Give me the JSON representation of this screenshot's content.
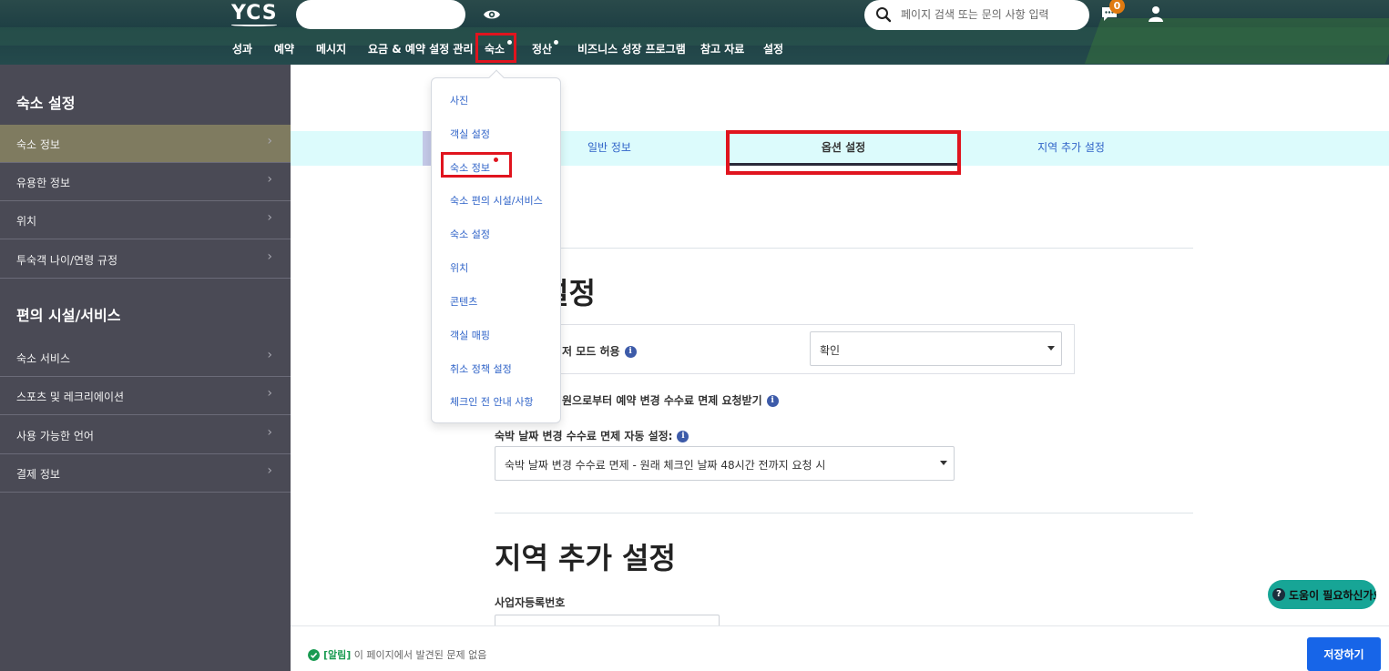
{
  "header": {
    "logo": "YCS",
    "top_input_value": "",
    "search_placeholder": "페이지 검색 또는 문의 사항 입력",
    "notification_count": "0"
  },
  "nav": {
    "items": [
      {
        "label": "성과"
      },
      {
        "label": "예약"
      },
      {
        "label": "메시지"
      },
      {
        "label": "요금 & 예약 설정 관리"
      },
      {
        "label": "숙소",
        "active": true,
        "dot": true
      },
      {
        "label": "정산",
        "dot": true
      },
      {
        "label": "비즈니스 성장 프로그램"
      },
      {
        "label": "참고 자료"
      },
      {
        "label": "설정"
      }
    ]
  },
  "sidebar": {
    "section1_title": "숙소 설정",
    "section1_items": [
      {
        "label": "숙소 정보",
        "active": true
      },
      {
        "label": "유용한 정보"
      },
      {
        "label": "위치"
      },
      {
        "label": "투숙객 나이/연령 규정"
      }
    ],
    "section2_title": "편의 시설/서비스",
    "section2_items": [
      {
        "label": "숙소 서비스"
      },
      {
        "label": "스포츠 및 레크리에이션"
      },
      {
        "label": "사용 가능한 언어"
      },
      {
        "label": "결제 정보"
      }
    ]
  },
  "dropdown": {
    "items": [
      {
        "label": "사진"
      },
      {
        "label": "객실 설정"
      },
      {
        "label": "숙소 정보",
        "highlighted": true
      },
      {
        "label": "숙소 편의 시설/서비스"
      },
      {
        "label": "숙소 설정"
      },
      {
        "label": "위치"
      },
      {
        "label": "콘텐츠"
      },
      {
        "label": "객실 매핑"
      },
      {
        "label": "취소 정책 설정"
      },
      {
        "label": "체크인 전 안내 사항"
      }
    ]
  },
  "tabs": {
    "items": [
      {
        "label": "일반 정보"
      },
      {
        "label": "옵션 설정",
        "active": true
      },
      {
        "label": "지역 추가 설정"
      }
    ]
  },
  "option_section": {
    "heading_partial": "설정",
    "row1_label": "저 모드 허용",
    "row1_value": "확인",
    "row2_label": "원으로부터 예약 변경 수수료 면제 요청받기",
    "row3_label": "숙박 날짜 변경 수수료 면제 자동 설정:",
    "row3_value": "숙박 날짜 변경 수수료 면제 - 원래 체크인 날짜 48시간 전까지 요청 시"
  },
  "region_section": {
    "heading": "지역 추가 설정",
    "biz_label": "사업자등록번호"
  },
  "footer": {
    "alert_tag": "[알림]",
    "alert_text": "이 페이지에서 발견된 문제 없음",
    "save_label": "저장하기",
    "help_label": "도움이 필요하신가요"
  },
  "colors": {
    "accent_blue": "#1765e8",
    "highlight_red": "#e0141e",
    "sidebar_bg": "#4a4a55",
    "sidebar_active": "#7f7b60",
    "tabbar_bg": "#dcfbfc",
    "help_teal": "#17a596",
    "success_green": "#1a9b52"
  }
}
